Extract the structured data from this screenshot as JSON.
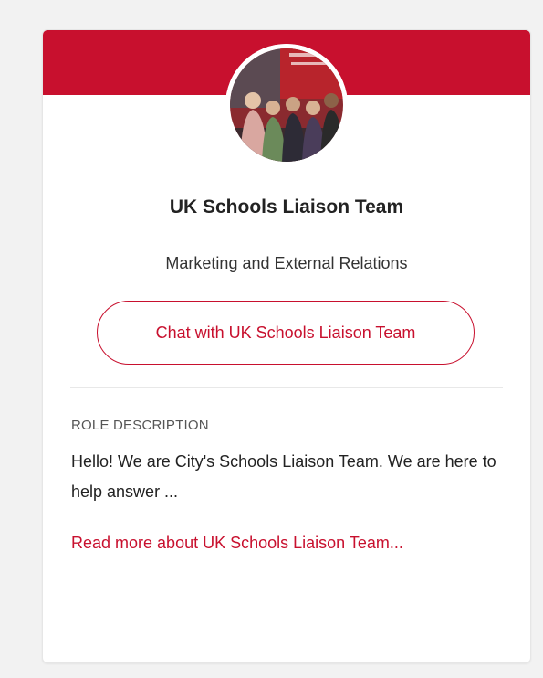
{
  "card": {
    "name": "UK Schools Liaison Team",
    "department": "Marketing and External Relations",
    "chat_button_label": "Chat with UK Schools Liaison Team",
    "role_heading": "ROLE DESCRIPTION",
    "role_description": "Hello! We are City's Schools Liaison Team. We are here to help answer ...",
    "read_more_label": "Read more about UK Schools Liaison Team...",
    "avatar_icon": "team-photo"
  },
  "colors": {
    "accent": "#c8102e",
    "background": "#f2f2f2",
    "card": "#ffffff",
    "text": "#222222"
  }
}
